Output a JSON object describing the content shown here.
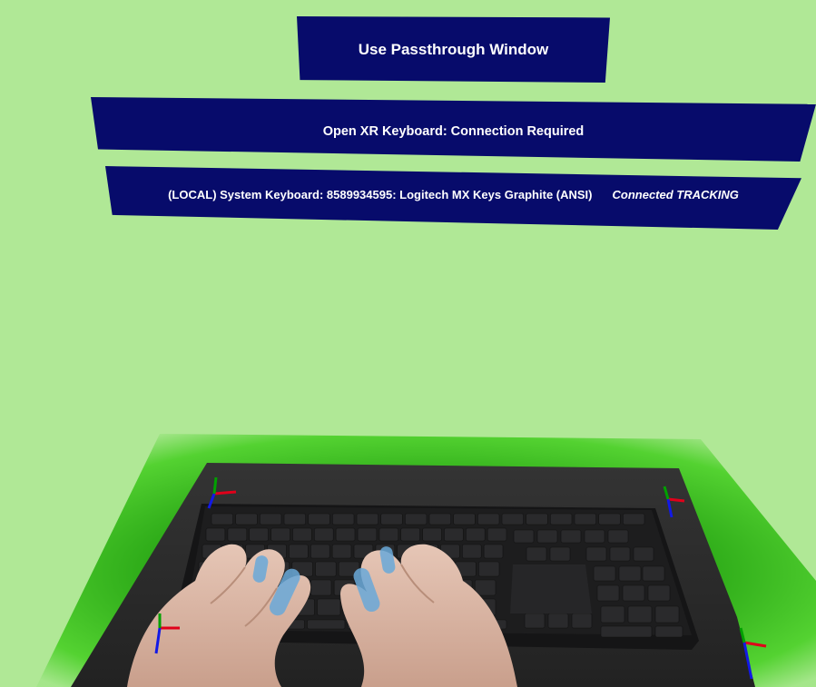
{
  "ui": {
    "passthrough_button_label": "Use Passthrough Window",
    "openxr_keyboard_status": "Open XR Keyboard: Connection Required",
    "system_keyboard": {
      "device_label": "(LOCAL) System Keyboard: 8589934595: Logitech MX Keys Graphite (ANSI)",
      "status": "Connected TRACKING"
    }
  },
  "colors": {
    "background": "#b0e896",
    "panel": "#070b6b",
    "panel_text": "#ffffff",
    "desk_border_green": "#2fb816",
    "desk_mat": "#2b2b2b",
    "keyboard": "#1b1b1c",
    "hands": "#d7b3a3",
    "fingertip_tracking": "#6aa9d9"
  },
  "icons": {
    "axis_markers": [
      "xyz-axis-icon",
      "xyz-axis-icon",
      "xyz-axis-icon",
      "xyz-axis-icon"
    ]
  }
}
